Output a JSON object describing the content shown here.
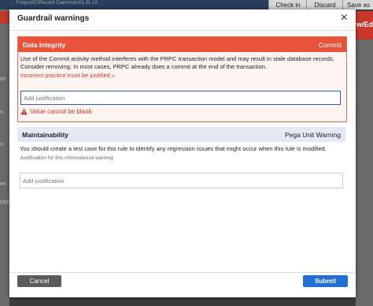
{
  "background": {
    "top_text": "... Fobject/ESRecord   ClaimAuto/01.01.15",
    "checkin_label": "Check in",
    "discard_label": "Discard",
    "saveas_label": "Save as",
    "right_banner": "w/Ed",
    "left_letters": [
      "en",
      "n",
      "n",
      "en",
      "ceps"
    ]
  },
  "modal": {
    "title": "Guardrail warnings",
    "close_glyph": "×"
  },
  "warning1": {
    "category": "Data Integrity",
    "type": "Commit",
    "message": "Use of the Commit activity method interferes with the PRPC transaction model and may result in stale database records. Consider removing; In most cases, PRPC already does a commit at the end of the transaction.",
    "link": "Incorrect practice must be justified »",
    "placeholder": "Add justification",
    "error": "Value cannot be blank",
    "header_color": "#e8533a"
  },
  "warning2": {
    "category": "Maintainability",
    "type": "Pega Unit Warning",
    "message": "You should create a test case for this rule to identify any regression issues that might occur when this rule is modified.",
    "field_label": "Justification for this informational warning",
    "placeholder": "Add justification"
  },
  "footer": {
    "cancel_label": "Cancel",
    "submit_label": "Submit",
    "submit_color": "#1f6fd6"
  }
}
